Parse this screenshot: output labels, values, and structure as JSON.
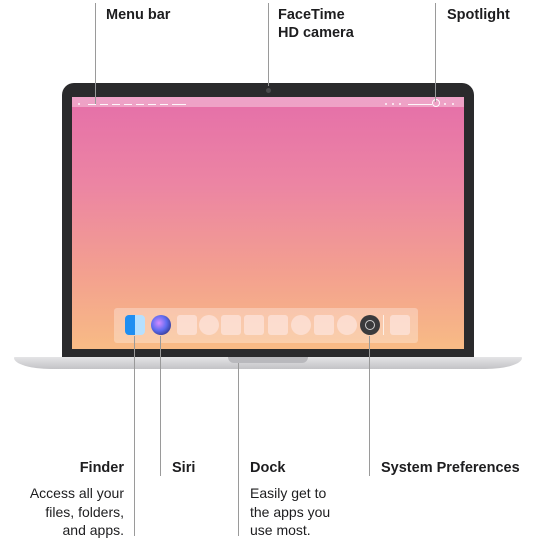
{
  "callouts": {
    "menu_bar": "Menu bar",
    "facetime_line1": "FaceTime",
    "facetime_line2": "HD camera",
    "spotlight": "Spotlight",
    "finder": "Finder",
    "finder_desc_1": "Access all your",
    "finder_desc_2": "files, folders,",
    "finder_desc_3": "and apps.",
    "siri": "Siri",
    "dock": "Dock",
    "dock_desc_1": "Easily get to",
    "dock_desc_2": "the apps you",
    "dock_desc_3": "use most.",
    "system_preferences": "System Preferences"
  },
  "colors": {
    "screen_top": "#e56fa9",
    "screen_bottom": "#f8bb85",
    "bezel": "#2a2a2c",
    "leader_line": "#9a9a9a"
  },
  "icons": [
    "finder-icon",
    "siri-icon",
    "system-preferences-icon",
    "spotlight-icon",
    "facetime-camera"
  ]
}
